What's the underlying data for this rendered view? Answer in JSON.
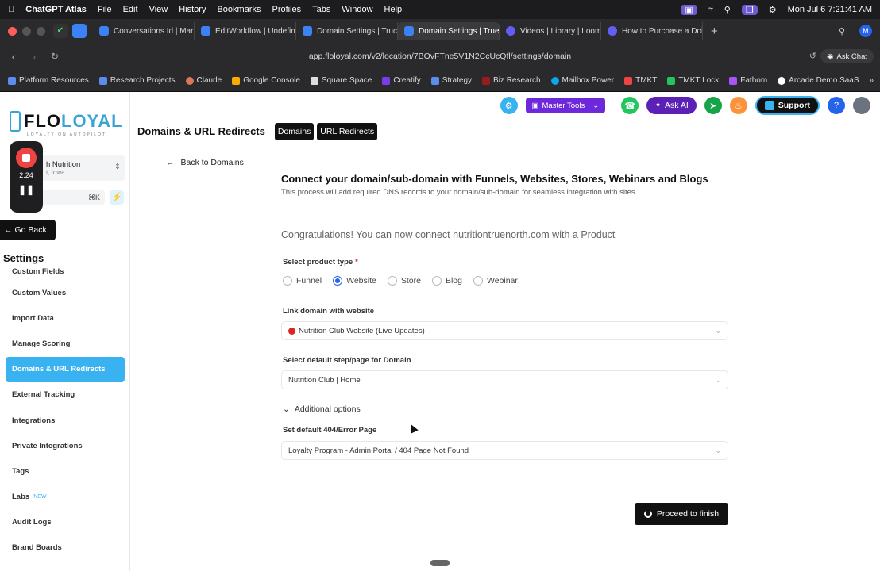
{
  "menubar": {
    "app": "ChatGPT Atlas",
    "menus": [
      "File",
      "Edit",
      "View",
      "History",
      "Bookmarks",
      "Profiles",
      "Tabs",
      "Window",
      "Help"
    ],
    "datetime": "Mon Jul 6  7:21:41 AM",
    "avatar": "M"
  },
  "browser": {
    "tabs": [
      {
        "label": "Conversations Id | Mar"
      },
      {
        "label": "EditWorkflow | Undefin"
      },
      {
        "label": "Domain Settings | Truc"
      },
      {
        "label": "Domain Settings | True",
        "active": true
      },
      {
        "label": "Videos | Library | Loom"
      },
      {
        "label": "How to Purchase a Doi"
      }
    ],
    "new_tab": "+",
    "url": "app.floloyal.com/v2/location/7BOvFTne5V1N2CcUcQfl/settings/domain",
    "ask_chat": "Ask Chat",
    "bookmarks": [
      "Platform Resources",
      "Research Projects",
      "Claude",
      "Google Console",
      "Square Space",
      "Creatify",
      "Strategy",
      "Biz Research",
      "Mailbox Power",
      "TMKT",
      "TMKT Lock",
      "Fathom",
      "Arcade Demo SaaS"
    ],
    "more": "»"
  },
  "sidebar": {
    "logo": {
      "flo": "FLO",
      "loyal": "LOYAL",
      "tagline": "LOYALTY ON AUTOPILOT"
    },
    "location": {
      "name": "h Nutrition",
      "sub": "t, Iowa"
    },
    "search": {
      "placeholder": "h",
      "shortcut": "⌘K"
    },
    "recorder_time": "2:24",
    "go_back": "Go Back",
    "settings_title": "Settings",
    "items": [
      {
        "label": "Custom Fields"
      },
      {
        "label": "Custom Values"
      },
      {
        "label": "Import Data"
      },
      {
        "label": "Manage Scoring"
      },
      {
        "label": "Domains & URL Redirects",
        "active": true
      },
      {
        "label": "External Tracking"
      },
      {
        "label": "Integrations"
      },
      {
        "label": "Private Integrations"
      },
      {
        "label": "Tags"
      },
      {
        "label": "Labs",
        "badge": "NEW"
      },
      {
        "label": "Audit Logs"
      },
      {
        "label": "Brand Boards"
      }
    ]
  },
  "topbar": {
    "master_tools": "Master Tools",
    "ask_ai": "Ask AI",
    "support": "Support",
    "help": "?"
  },
  "page": {
    "title": "Domains & URL Redirects",
    "tabs": [
      "Domains",
      "URL Redirects"
    ],
    "back": "Back to Domains",
    "heading": "Connect your domain/sub-domain with Funnels, Websites, Stores, Webinars and Blogs",
    "subheading": "This process will add required DNS records to your domain/sub-domain for seamless integration with sites",
    "congrats": "Congratulations! You can now connect nutritiontruenorth.com with a Product",
    "product_type_label": "Select product type",
    "required_mark": "*",
    "product_types": [
      {
        "label": "Funnel",
        "selected": false
      },
      {
        "label": "Website",
        "selected": true
      },
      {
        "label": "Store",
        "selected": false
      },
      {
        "label": "Blog",
        "selected": false
      },
      {
        "label": "Webinar",
        "selected": false
      }
    ],
    "link_label": "Link domain with website",
    "link_value": "Nutrition Club Website (Live Updates)",
    "step_label": "Select default step/page for Domain",
    "step_value": "Nutrition Club | Home",
    "additional_options": "Additional options",
    "error_label": "Set default 404/Error Page",
    "error_value": "Loyalty Program - Admin Portal / 404 Page Not Found",
    "proceed": "Proceed to finish"
  },
  "colors": {
    "accent": "#38b2f0",
    "primary_dark": "#111111",
    "purple": "#6d28d9",
    "radio_blue": "#2563eb"
  }
}
